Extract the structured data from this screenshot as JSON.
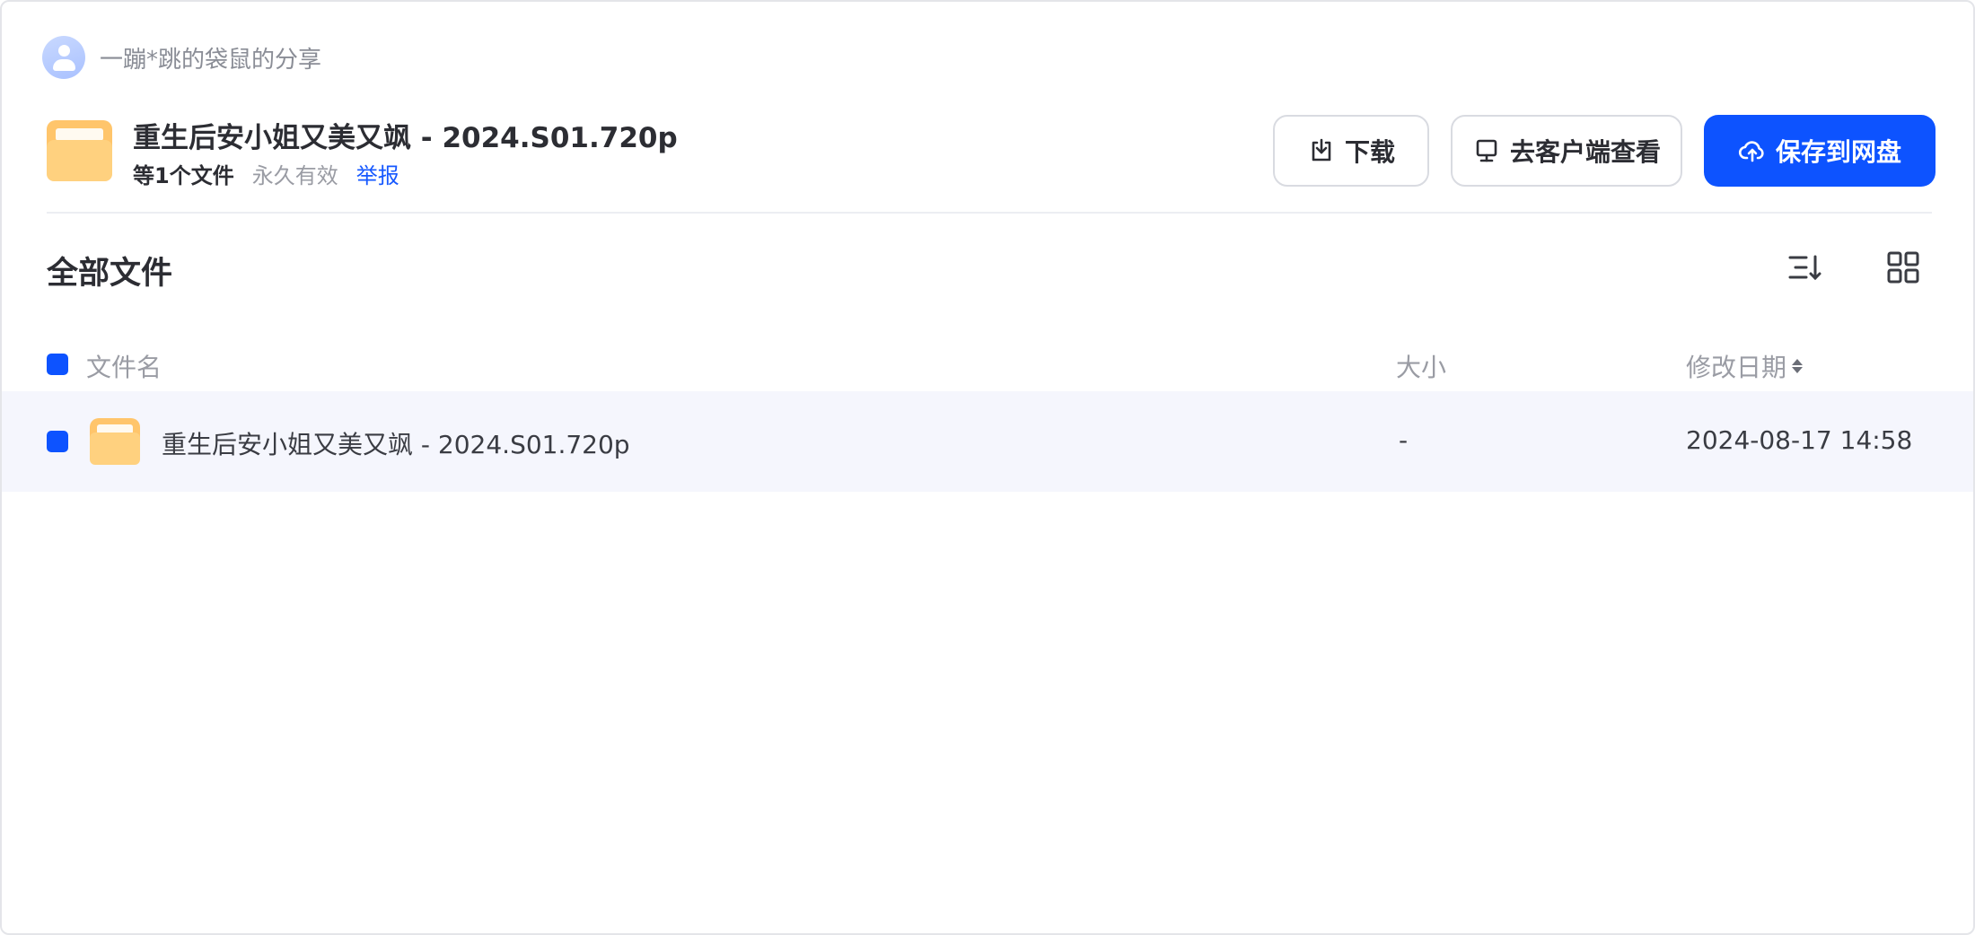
{
  "sharer": {
    "name": "一蹦*跳的袋鼠的分享",
    "avatar_icon": "user-avatar-icon"
  },
  "share": {
    "title": "重生后安小姐又美又飒 - 2024.S01.720p",
    "file_count": "等1个文件",
    "validity": "永久有效",
    "report_label": "举报"
  },
  "actions": {
    "download_label": "下载",
    "client_label": "去客户端查看",
    "save_label": "保存到网盘"
  },
  "section": {
    "title": "全部文件"
  },
  "table": {
    "columns": {
      "name": "文件名",
      "size": "大小",
      "modified": "修改日期"
    },
    "rows": [
      {
        "name": "重生后安小姐又美又飒 - 2024.S01.720p",
        "size": "-",
        "modified": "2024-08-17 14:58",
        "type": "folder"
      }
    ]
  },
  "colors": {
    "primary": "#0d53ff",
    "folder": "#ffc56b",
    "row_highlight": "#f5f6fd"
  }
}
